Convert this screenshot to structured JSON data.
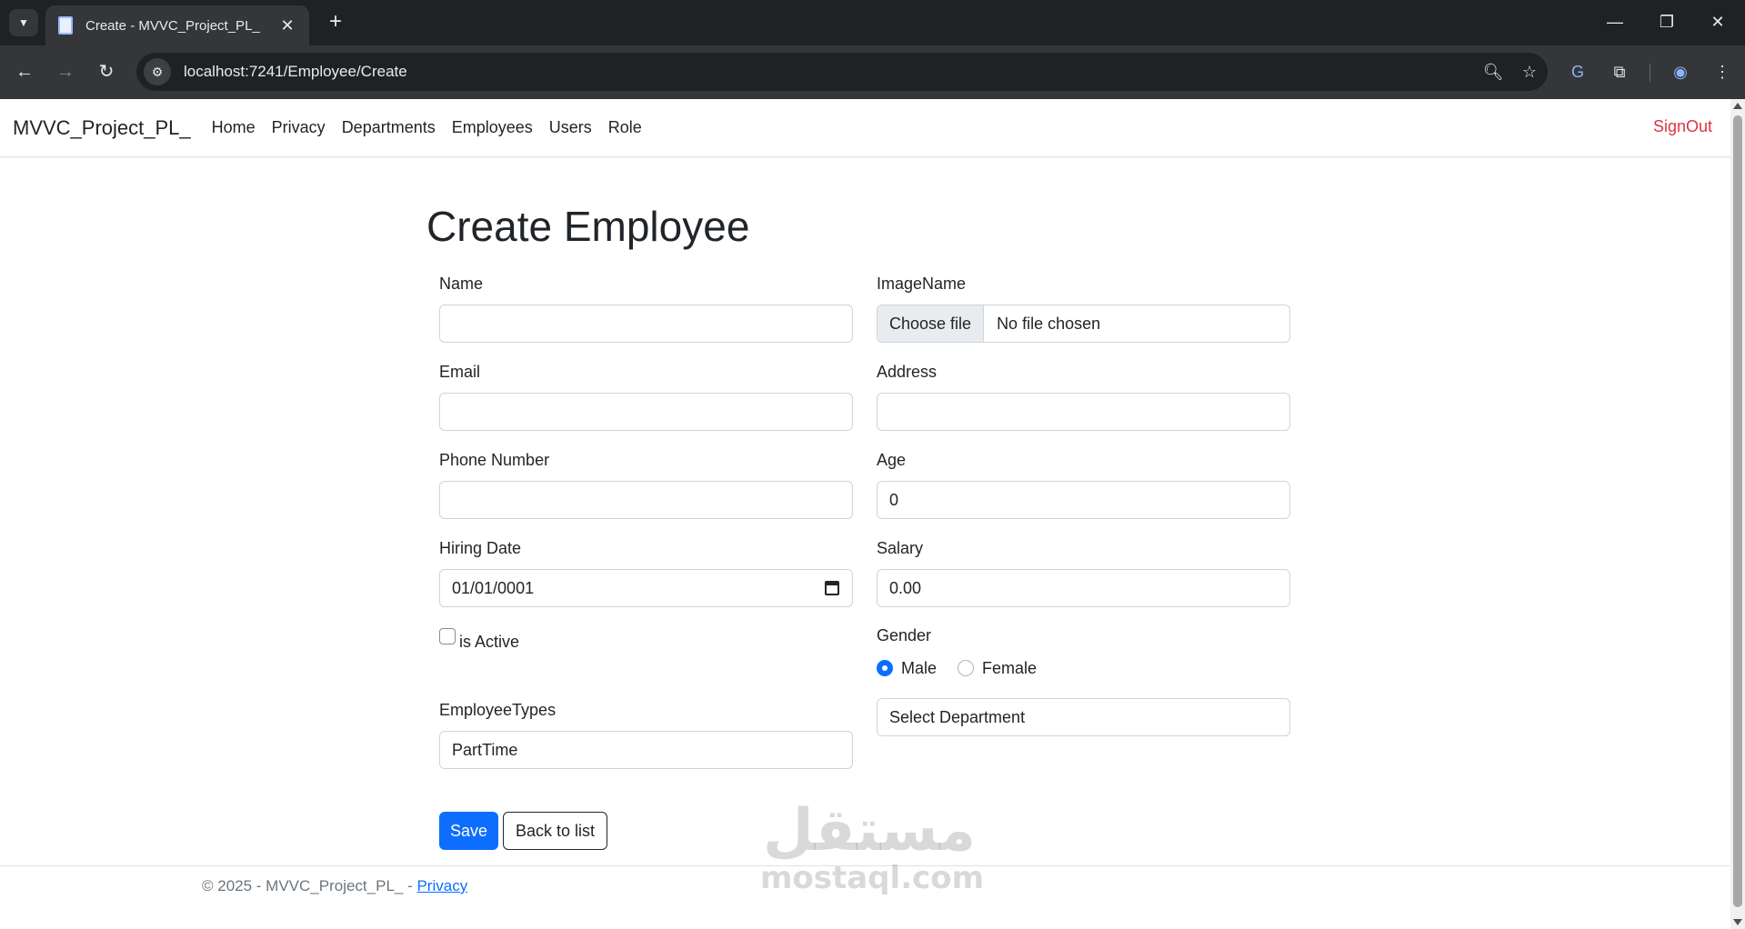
{
  "browser": {
    "tab_title": "Create - MVVC_Project_PL_",
    "url": "localhost:7241/Employee/Create"
  },
  "navbar": {
    "brand": "MVVC_Project_PL_",
    "links": [
      "Home",
      "Privacy",
      "Departments",
      "Employees",
      "Users",
      "Role"
    ],
    "signout": "SignOut"
  },
  "page": {
    "title": "Create Employee"
  },
  "form": {
    "name_label": "Name",
    "name_value": "",
    "email_label": "Email",
    "email_value": "",
    "phone_label": "Phone Number",
    "phone_value": "",
    "hiring_date_label": "Hiring Date",
    "hiring_date_value": "01/01/0001",
    "is_active_label": "is Active",
    "employee_types_label": "EmployeeTypes",
    "employee_types_value": "PartTime",
    "image_label": "ImageName",
    "choose_file_button": "Choose file",
    "no_file_text": "No file chosen",
    "address_label": "Address",
    "address_value": "",
    "age_label": "Age",
    "age_value": "0",
    "salary_label": "Salary",
    "salary_value": "0.00",
    "gender_label": "Gender",
    "gender_options": [
      "Male",
      "Female"
    ],
    "gender_selected": "Male",
    "department_value": "Select Department",
    "save_button": "Save",
    "back_button": "Back to list"
  },
  "footer": {
    "text": "© 2025 - MVVC_Project_PL_ - ",
    "privacy_link": "Privacy"
  },
  "watermark": {
    "arabic": "مستقل",
    "latin": "mostaql.com"
  },
  "colors": {
    "primary": "#0d6efd",
    "signout": "#dc3545",
    "chrome_dark": "#202124",
    "chrome_toolbar": "#35363a"
  }
}
